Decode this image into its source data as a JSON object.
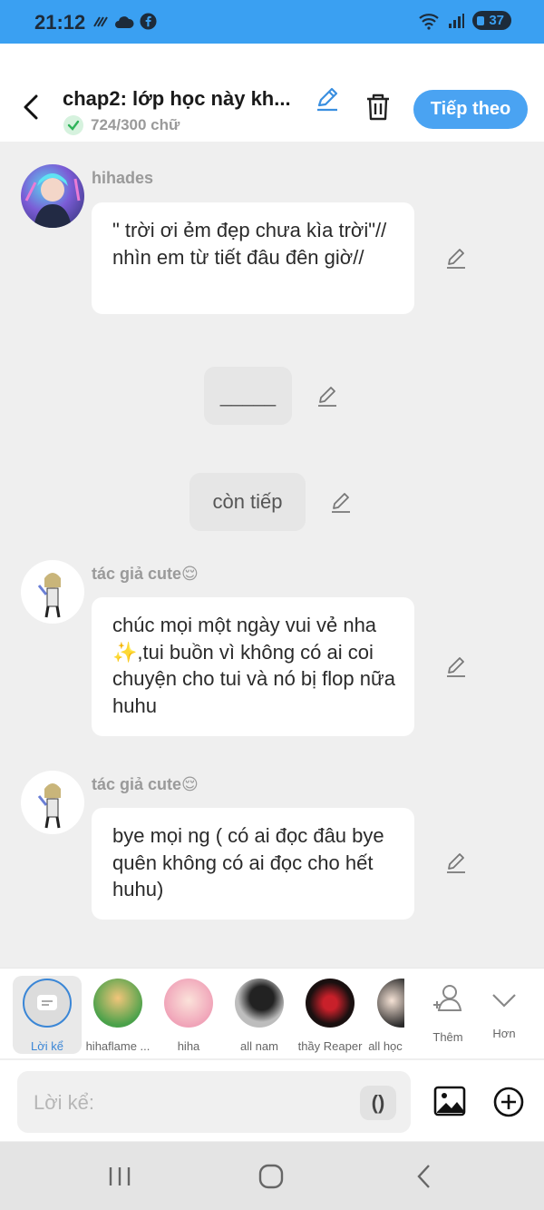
{
  "status_bar": {
    "time": "21:12",
    "battery": "37"
  },
  "header": {
    "title": "chap2: lớp học này kh...",
    "word_count": "724/300 chữ",
    "next_button": "Tiếp theo"
  },
  "messages": [
    {
      "sender": "hihades",
      "text": "\" trời ơi ẻm đẹp chưa kìa trời\"// nhìn em từ tiết đâu đên giờ//"
    },
    {
      "text": "_____"
    },
    {
      "text": "còn tiếp"
    },
    {
      "sender": "tác giả cute😌",
      "text": "chúc mọi một ngày vui vẻ nha ✨,tui buồn vì không có ai coi chuyện cho tui và nó bị flop nữa huhu"
    },
    {
      "sender": "tác giả cute😌",
      "text": "bye mọi ng ( có ai đọc đâu bye quên không có ai đọc cho hết huhu)"
    }
  ],
  "characters": [
    {
      "name": "Lời kể"
    },
    {
      "name": "hihaflame ..."
    },
    {
      "name": "hiha"
    },
    {
      "name": "all nam"
    },
    {
      "name": "thầy Reaper"
    },
    {
      "name": "all học"
    },
    {
      "name": "Thêm"
    },
    {
      "name": "Hơn"
    }
  ],
  "input": {
    "placeholder": "Lời kể:",
    "paren_button": "()"
  },
  "colors": {
    "accent": "#4aa3f2",
    "status_bar": "#3aa0f2",
    "background": "#efefef"
  }
}
